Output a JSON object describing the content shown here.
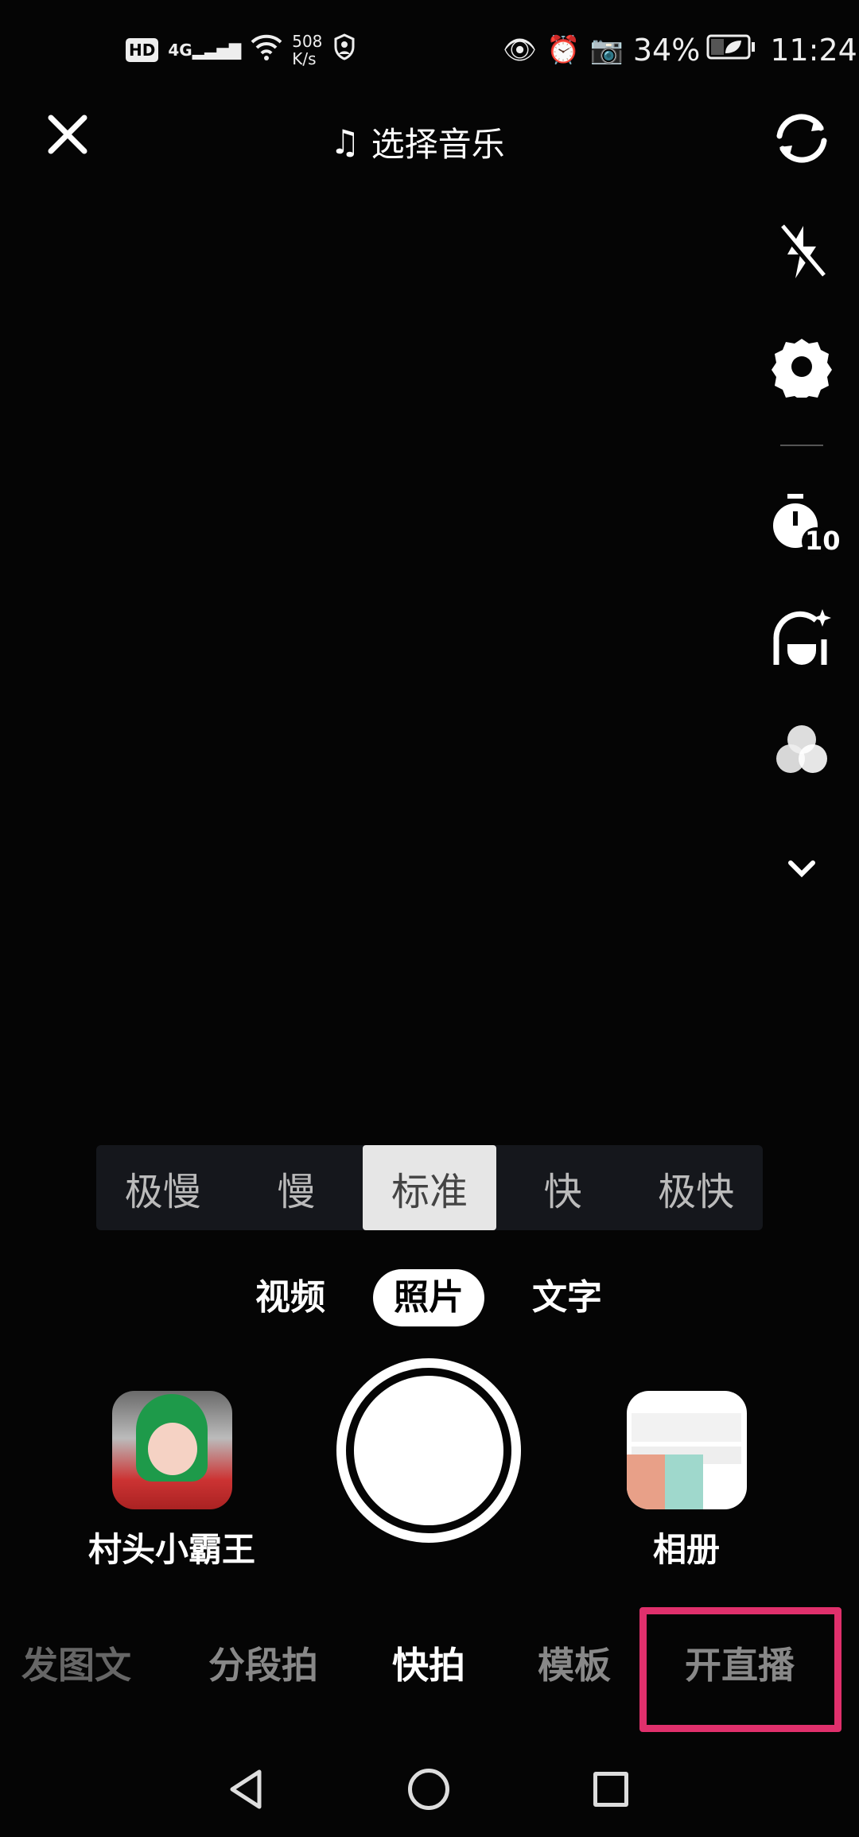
{
  "status_bar": {
    "network_speed_value": "508",
    "network_speed_unit": "K/s",
    "signal": "4G",
    "battery": "34%",
    "time": "11:24",
    "icons": [
      "hd-icon",
      "signal-icon",
      "wifi-icon",
      "shield-icon",
      "eye-icon",
      "alarm-icon",
      "camera-icon",
      "battery-icon"
    ]
  },
  "top_bar": {
    "close_icon": "close-icon",
    "music_label": "选择音乐",
    "flip_icon": "flip-camera-icon"
  },
  "side_tools": [
    "flash-off-icon",
    "settings-icon",
    "timer-icon",
    "beauty-icon",
    "filter-icon",
    "chevron-down-icon"
  ],
  "timer_value": "10",
  "speed": {
    "options": [
      "极慢",
      "慢",
      "标准",
      "快",
      "极快"
    ],
    "selected": "标准"
  },
  "modes": {
    "items": [
      "视频",
      "照片",
      "文字"
    ],
    "selected": "照片"
  },
  "effect": {
    "label": "村头小霸王"
  },
  "album": {
    "label": "相册"
  },
  "bottom_tabs": {
    "items": [
      "发图文",
      "分段拍",
      "快拍",
      "模板",
      "开直播"
    ],
    "selected": "快拍",
    "highlighted": "开直播",
    "highlight_color": "#e0306c"
  },
  "nav": [
    "back-icon",
    "home-icon",
    "recents-icon"
  ]
}
